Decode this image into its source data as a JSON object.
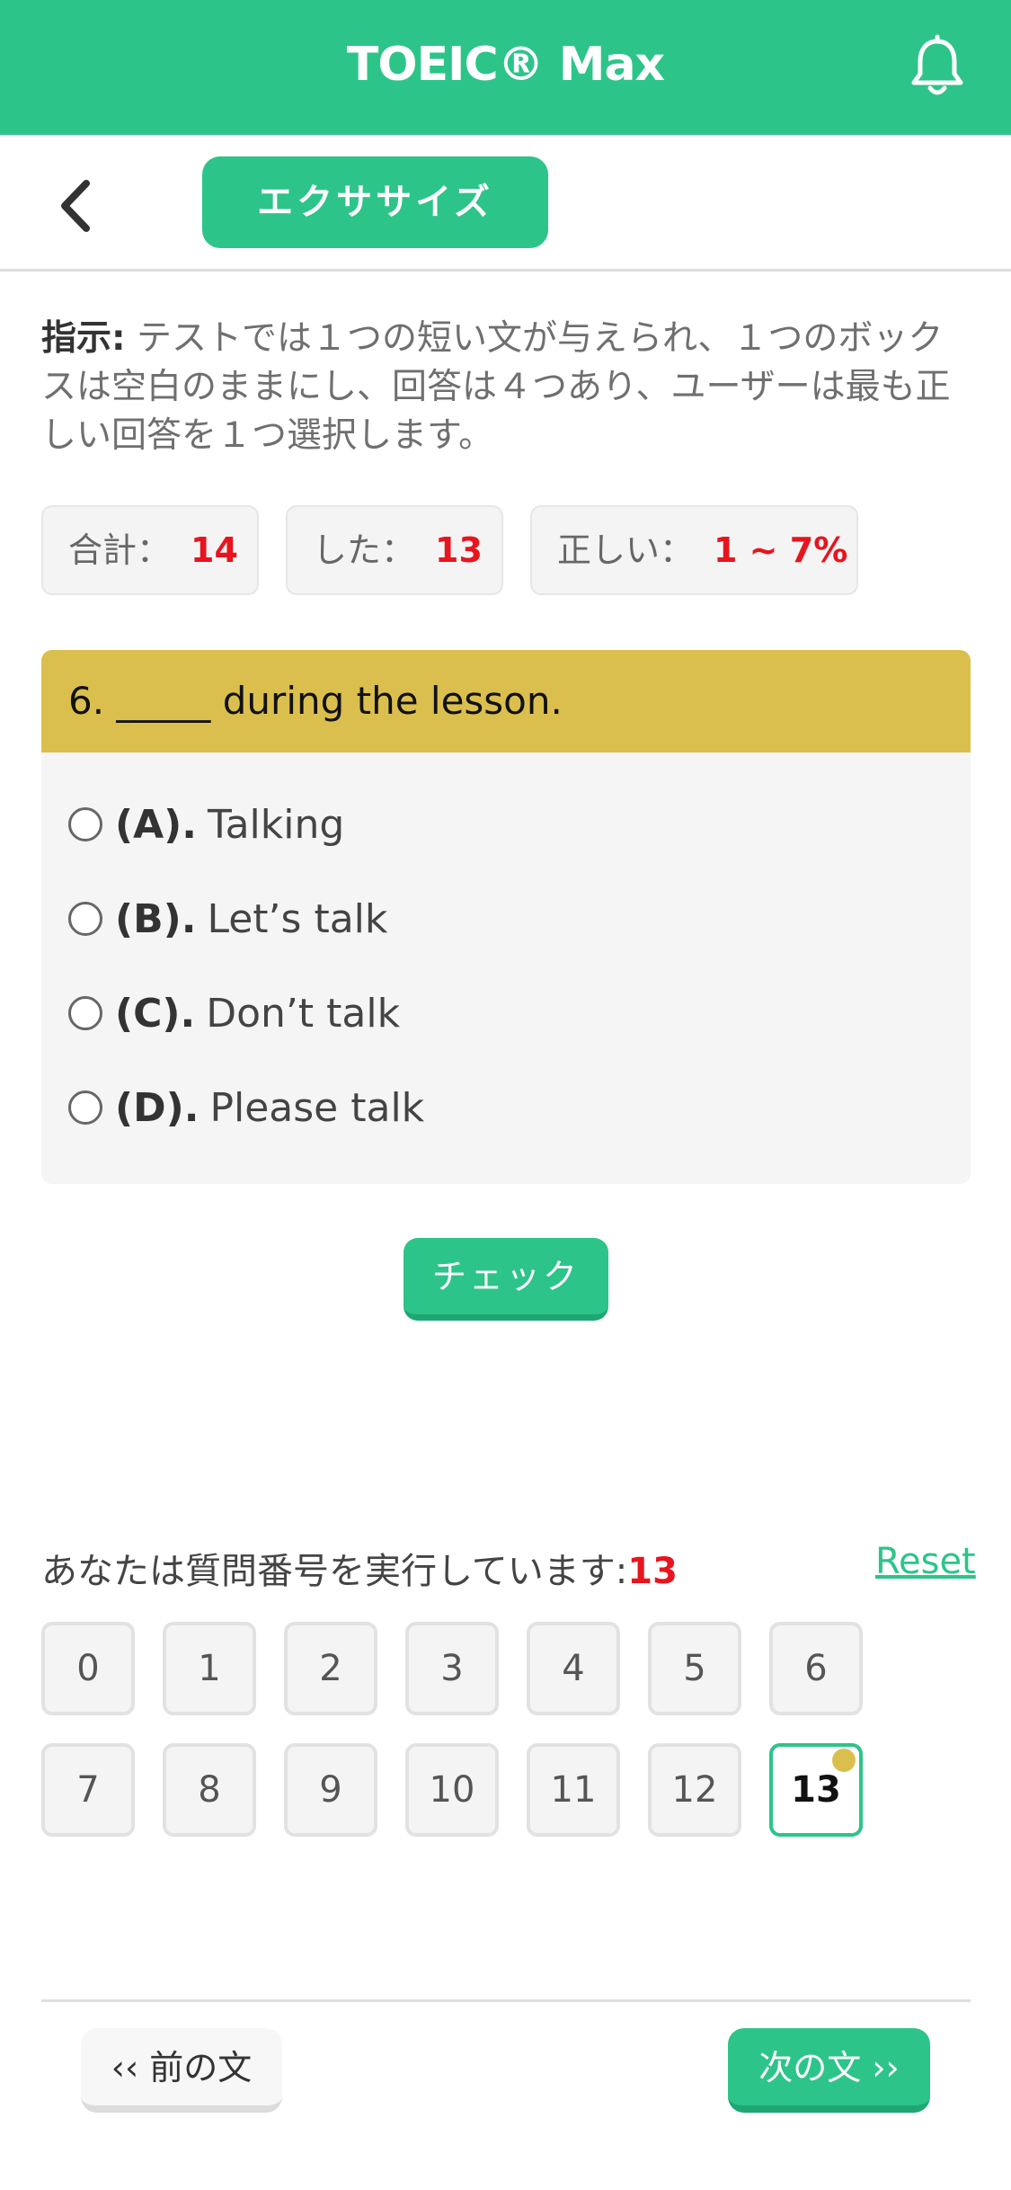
{
  "header": {
    "title": "TOEIC® Max",
    "bell_icon": "bell-icon"
  },
  "subbar": {
    "back_icon": "chevron-left-icon",
    "exercise_label": "エクササイズ"
  },
  "instructions": {
    "label": "指示:",
    "text": "テストでは１つの短い文が与えられ、１つのボックスは空白のままにし、回答は４つあり、ユーザーは最も正しい回答を１つ選択します。"
  },
  "stats": [
    {
      "label": "合計：",
      "value": "14"
    },
    {
      "label": "した：",
      "value": "13"
    },
    {
      "label": "正しい：",
      "value": "1 ~ 7%"
    }
  ],
  "question": {
    "text": "6. _____ during the lesson.",
    "options": [
      {
        "key": "(A).",
        "text": "Talking"
      },
      {
        "key": "(B).",
        "text": "Let’s talk"
      },
      {
        "key": "(C).",
        "text": "Don’t talk"
      },
      {
        "key": "(D).",
        "text": "Please talk"
      }
    ]
  },
  "check_label": "チェック",
  "progress": {
    "label": "あなたは質問番号を実行しています:",
    "current": "13",
    "reset_label": "Reset"
  },
  "question_numbers": [
    "0",
    "1",
    "2",
    "3",
    "4",
    "5",
    "6",
    "7",
    "8",
    "9",
    "10",
    "11",
    "12",
    "13"
  ],
  "current_index": 13,
  "nav": {
    "prev_label": "‹‹ 前の文",
    "next_label": "次の文 ››"
  },
  "colors": {
    "accent": "#2dc48a",
    "question_header": "#dbbf4e",
    "highlight": "#e8141e"
  }
}
